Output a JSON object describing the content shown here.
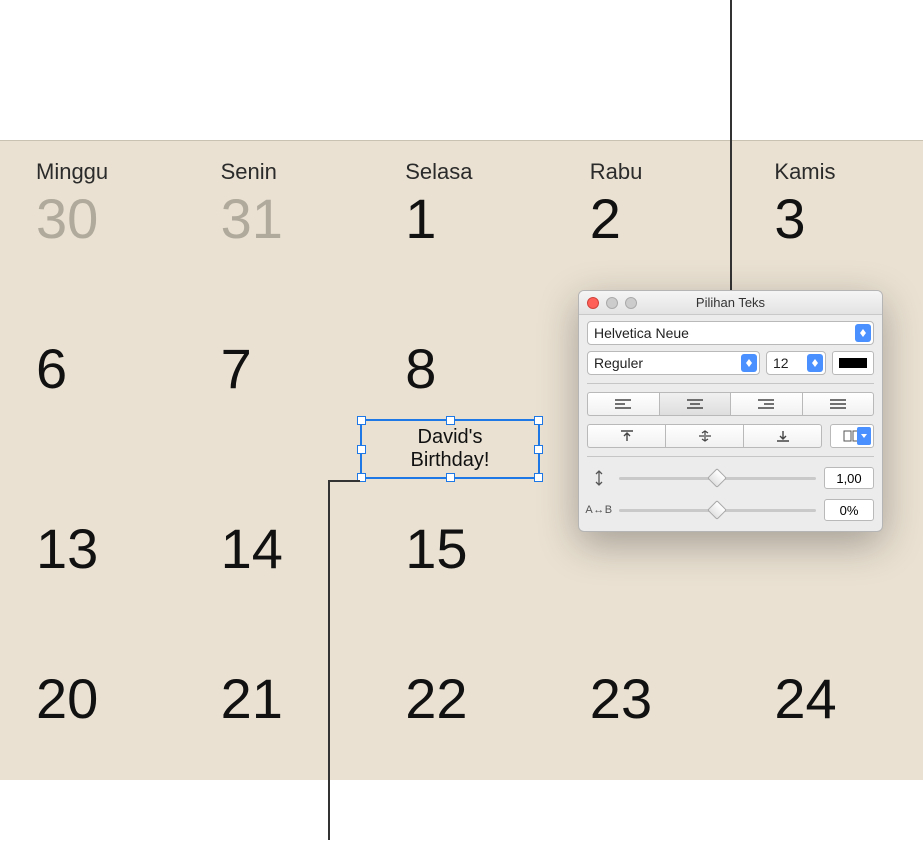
{
  "calendar": {
    "day_headers": [
      "Minggu",
      "Senin",
      "Selasa",
      "Rabu",
      "Kamis"
    ],
    "rows": [
      [
        "30",
        "31",
        "1",
        "2",
        "3"
      ],
      [
        "6",
        "7",
        "8",
        "",
        ""
      ],
      [
        "13",
        "14",
        "15",
        "",
        ""
      ],
      [
        "20",
        "21",
        "22",
        "23",
        "24"
      ]
    ],
    "faded": [
      [
        0,
        0
      ],
      [
        0,
        1
      ]
    ],
    "event_text": "David's\nBirthday!"
  },
  "panel": {
    "title": "Pilihan Teks",
    "font_family": "Helvetica Neue",
    "font_style": "Reguler",
    "font_size": "12",
    "line_spacing_value": "1,00",
    "char_spacing_value": "0%"
  }
}
